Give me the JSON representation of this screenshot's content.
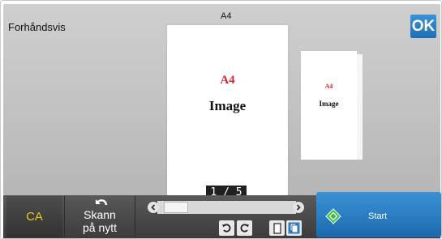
{
  "header": {
    "title": "Forhåndsvis",
    "paper_size": "A4",
    "ok_label": "OK"
  },
  "preview": {
    "current_page": {
      "paper_label": "A4",
      "type_label": "Image"
    },
    "next_page": {
      "paper_label": "A4",
      "type_label": "Image"
    },
    "page_counter": "1 / 5"
  },
  "footer": {
    "ca_label": "CA",
    "rescan_line1": "Skann",
    "rescan_line2": "på nytt",
    "start_label": "Start"
  },
  "icons": {
    "rescan": "undo-arrow-icon",
    "slider_left": "chevron-left-icon",
    "slider_right": "chevron-right-icon",
    "rotate_left": "rotate-left-icon",
    "rotate_right": "rotate-right-icon",
    "single_page": "single-page-icon",
    "multi_page": "multi-page-icon",
    "start": "start-diamond-icon"
  },
  "colors": {
    "accent_blue": "#1f6fb6",
    "ca_text": "#f0c419",
    "paper_label_red": "#d9262c",
    "start_icon_green": "#3fbf4a"
  }
}
